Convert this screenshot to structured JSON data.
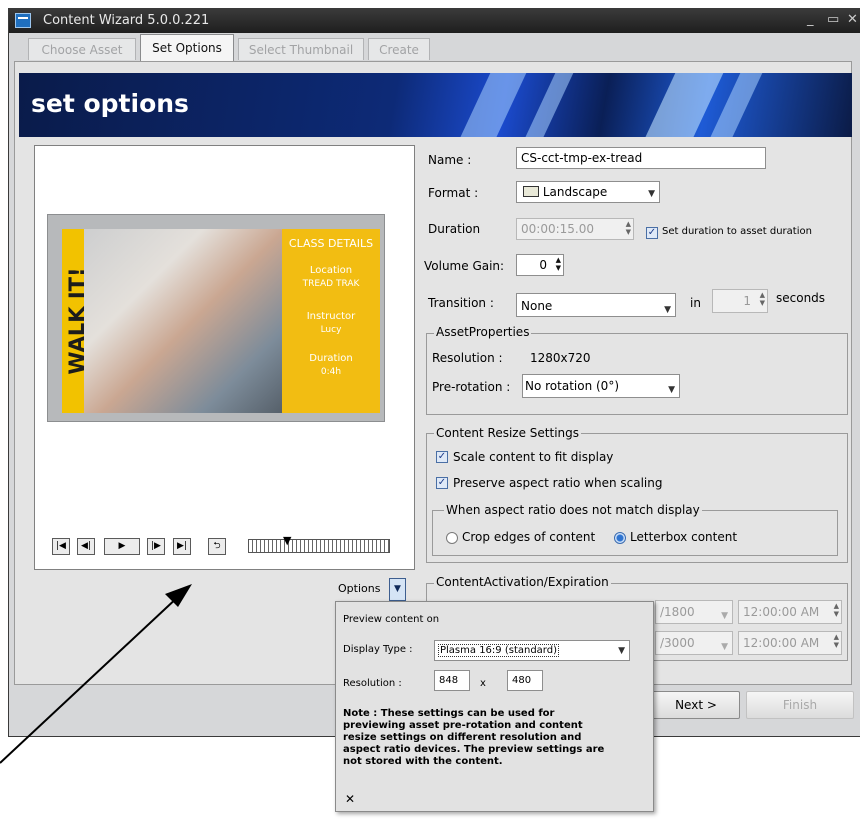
{
  "window": {
    "title": "Content Wizard 5.0.0.221",
    "controls": [
      "minimize",
      "maximize",
      "close"
    ]
  },
  "tabs": [
    {
      "label": "Choose Asset",
      "state": "disabled"
    },
    {
      "label": "Set Options",
      "state": "active"
    },
    {
      "label": "Select Thumbnail",
      "state": "disabled"
    },
    {
      "label": "Create",
      "state": "disabled"
    }
  ],
  "banner": {
    "title": "set options"
  },
  "preview": {
    "ad": {
      "walk_text": "WALK IT!",
      "header": "CLASS DETAILS",
      "location_label": "Location",
      "location_value": "TREAD TRAK",
      "instructor_label": "Instructor",
      "instructor_value": "Lucy",
      "duration_label": "Duration",
      "duration_value": "0:4h"
    },
    "transport_icons": [
      "first-frame-icon",
      "step-back-icon",
      "play-icon",
      "step-forward-icon",
      "last-frame-icon",
      "loop-icon"
    ],
    "options_label": "Options"
  },
  "form": {
    "name_label": "Name :",
    "name_value": "CS-cct-tmp-ex-tread",
    "format_label": "Format :",
    "format_value": "Landscape",
    "duration_label": "Duration",
    "duration_value": "00:00:15.00",
    "duration_checkbox_label": "Set duration to asset duration",
    "volume_label": "Volume Gain:",
    "volume_value": "0",
    "transition_label": "Transition :",
    "transition_value": "None",
    "transition_in_label": "in",
    "transition_seconds_value": "1",
    "transition_seconds_label": "seconds"
  },
  "asset_properties": {
    "legend": "AssetProperties",
    "resolution_label": "Resolution :",
    "resolution_value": "1280x720",
    "prerotation_label": "Pre-rotation :",
    "prerotation_value": "No rotation (0°)"
  },
  "resize": {
    "legend": "Content Resize Settings",
    "scale_label": "Scale content to fit display",
    "preserve_label": "Preserve aspect ratio when scaling",
    "mismatch_legend": "When aspect ratio does not match display",
    "crop_label": "Crop edges of content",
    "letterbox_label": "Letterbox content",
    "selected": "Letterbox content"
  },
  "activation": {
    "legend": "ContentActivation/Expiration",
    "start_date": "/1800",
    "start_time": "12:00:00 AM",
    "end_date": "/3000",
    "end_time": "12:00:00 AM"
  },
  "footer": {
    "next_label": "Next >",
    "finish_label": "Finish"
  },
  "popup": {
    "heading": "Preview content on",
    "display_type_label": "Display Type :",
    "display_type_value": "Plasma 16:9 (standard)",
    "resolution_label": "Resolution :",
    "res_width": "848",
    "res_x": "x",
    "res_height": "480",
    "note_lines": [
      "Note : These settings can be used for",
      "previewing asset pre-rotation and content",
      "resize settings on different resolution and",
      "aspect ratio devices. The preview settings are",
      "not stored with the content."
    ],
    "close_glyph": "✕"
  }
}
